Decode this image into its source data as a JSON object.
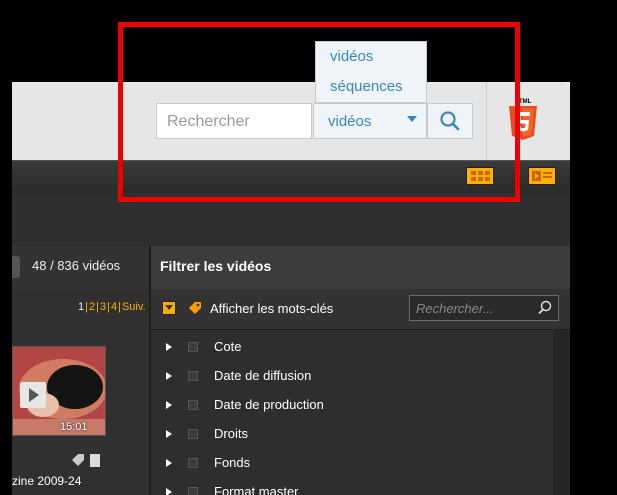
{
  "header": {
    "search_placeholder": "Rechercher",
    "select_value": "vidéos",
    "dropdown_options": [
      "vidéos",
      "séquences"
    ],
    "html5_badge": "HTML"
  },
  "list_header": {
    "count": "48 / 836 vidéos"
  },
  "filter_panel": {
    "title": "Filtrer les vidéos",
    "show_keywords": "Afficher les mots-clés",
    "search_placeholder": "Rechercher...",
    "items": [
      "Cote",
      "Date de diffusion",
      "Date de production",
      "Droits",
      "Fonds",
      "Format master"
    ]
  },
  "pager": {
    "current": "1",
    "pages": [
      "2",
      "3",
      "4"
    ],
    "next": "Suiv."
  },
  "video": {
    "duration": "15:01",
    "title_fragment": "zine 2009-24"
  },
  "colors": {
    "accent": "#ffb000",
    "link_blue": "#3b86b8",
    "highlight_frame": "#ee0000"
  }
}
